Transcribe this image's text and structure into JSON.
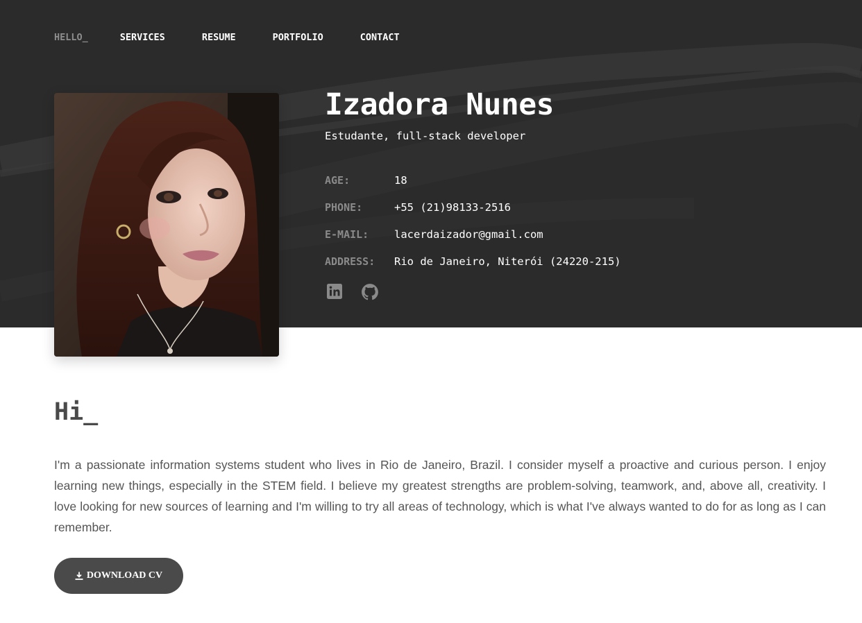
{
  "nav": {
    "items": [
      {
        "label": "HELLO_",
        "active": true
      },
      {
        "label": "SERVICES",
        "active": false
      },
      {
        "label": "RESUME",
        "active": false
      },
      {
        "label": "PORTFOLIO",
        "active": false
      },
      {
        "label": "CONTACT",
        "active": false
      }
    ]
  },
  "profile": {
    "name": "Izadora Nunes",
    "subtitle": "Estudante, full-stack developer",
    "info": [
      {
        "label": "AGE:",
        "value": "18"
      },
      {
        "label": "PHONE:",
        "value": "+55 (21)98133-2516"
      },
      {
        "label": "E-MAIL:",
        "value": "lacerdaizador@gmail.com"
      },
      {
        "label": "ADDRESS:",
        "value": "Rio de Janeiro, Niterói (24220-215)"
      }
    ],
    "socials": [
      {
        "icon": "linkedin-icon"
      },
      {
        "icon": "github-icon"
      }
    ]
  },
  "about": {
    "heading": "Hi_",
    "text": "I'm a passionate information systems student who lives in Rio de Janeiro, Brazil. I consider myself a proactive and curious person. I enjoy learning new things, especially in the STEM field. I believe my greatest strengths are problem-solving, teamwork, and, above all, creativity. I love looking for new sources of learning and I'm willing to try all areas of technology, which is what I've always wanted to do for as long as I can remember.",
    "download_label": "DOWNLOAD CV",
    "download_icon": "download-icon"
  },
  "colors": {
    "hero_bg": "#2b2b2b",
    "nav_active": "#8d8d8d",
    "button_bg": "#4a4a4a",
    "label_gray": "#8a8a8a"
  }
}
